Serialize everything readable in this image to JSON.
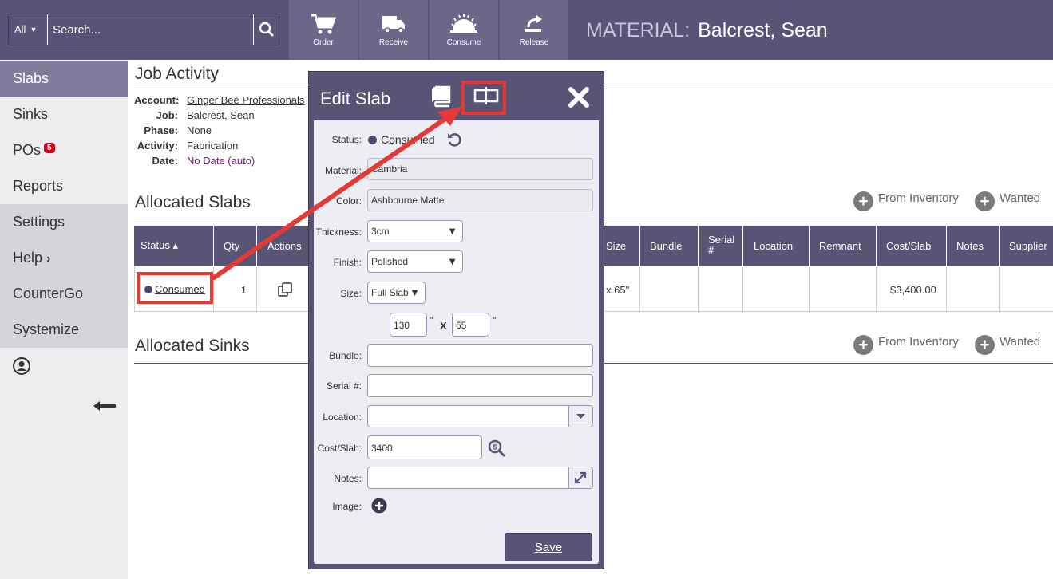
{
  "topbar": {
    "search_scope": "All",
    "search_placeholder": "Search...",
    "tools": [
      {
        "label": "Order",
        "icon": "cart-icon"
      },
      {
        "label": "Receive",
        "icon": "truck-icon"
      },
      {
        "label": "Consume",
        "icon": "saw-blade-icon"
      },
      {
        "label": "Release",
        "icon": "release-icon"
      }
    ],
    "material_label": "MATERIAL:",
    "material_name": "Balcrest, Sean"
  },
  "sidebar": {
    "items": [
      {
        "label": "Slabs"
      },
      {
        "label": "Sinks"
      },
      {
        "label": "POs",
        "badge": "5"
      },
      {
        "label": "Reports"
      },
      {
        "label": "Settings"
      },
      {
        "label": "Help"
      },
      {
        "label": "CounterGo"
      },
      {
        "label": "Systemize"
      }
    ]
  },
  "job": {
    "heading": "Job Activity",
    "account_label": "Account:",
    "account": "Ginger Bee Professionals",
    "job_label": "Job:",
    "job": "Balcrest, Sean",
    "phase_label": "Phase:",
    "phase": "None",
    "activity_label": "Activity:",
    "activity": "Fabrication",
    "date_label": "Date:",
    "date": "No Date (auto)"
  },
  "allocated_slabs": {
    "heading": "Allocated Slabs",
    "from_inventory": "From Inventory",
    "wanted": "Wanted",
    "columns": [
      "Status ▴",
      "Qty",
      "Actions",
      "Size",
      "Bundle",
      "Serial #",
      "Location",
      "Remnant",
      "Cost/Slab",
      "Notes",
      "Supplier"
    ],
    "row": {
      "status": "Consumed",
      "qty": "1",
      "size": "x 65\"",
      "cost": "$3,400.00"
    }
  },
  "allocated_sinks": {
    "heading": "Allocated Sinks",
    "from_inventory": "From Inventory",
    "wanted": "Wanted"
  },
  "modal": {
    "title": "Edit Slab",
    "status_label": "Status:",
    "status": "Consumed",
    "material_label": "Material:",
    "material": "Cambria",
    "color_label": "Color:",
    "color": "Ashbourne Matte",
    "thickness_label": "Thickness:",
    "thickness": "3cm",
    "finish_label": "Finish:",
    "finish": "Polished",
    "size_label": "Size:",
    "size": "Full Slab",
    "width": "130",
    "height": "65",
    "inch": "\"",
    "x": "X",
    "bundle_label": "Bundle:",
    "serial_label": "Serial #:",
    "location_label": "Location:",
    "cost_label": "Cost/Slab:",
    "cost": "3400",
    "notes_label": "Notes:",
    "image_label": "Image:",
    "save": "Save"
  },
  "colors": {
    "accent": "#575475",
    "annotation": "#e53935",
    "status_dot": "#4a4870",
    "date_purple": "#7a1a86"
  }
}
